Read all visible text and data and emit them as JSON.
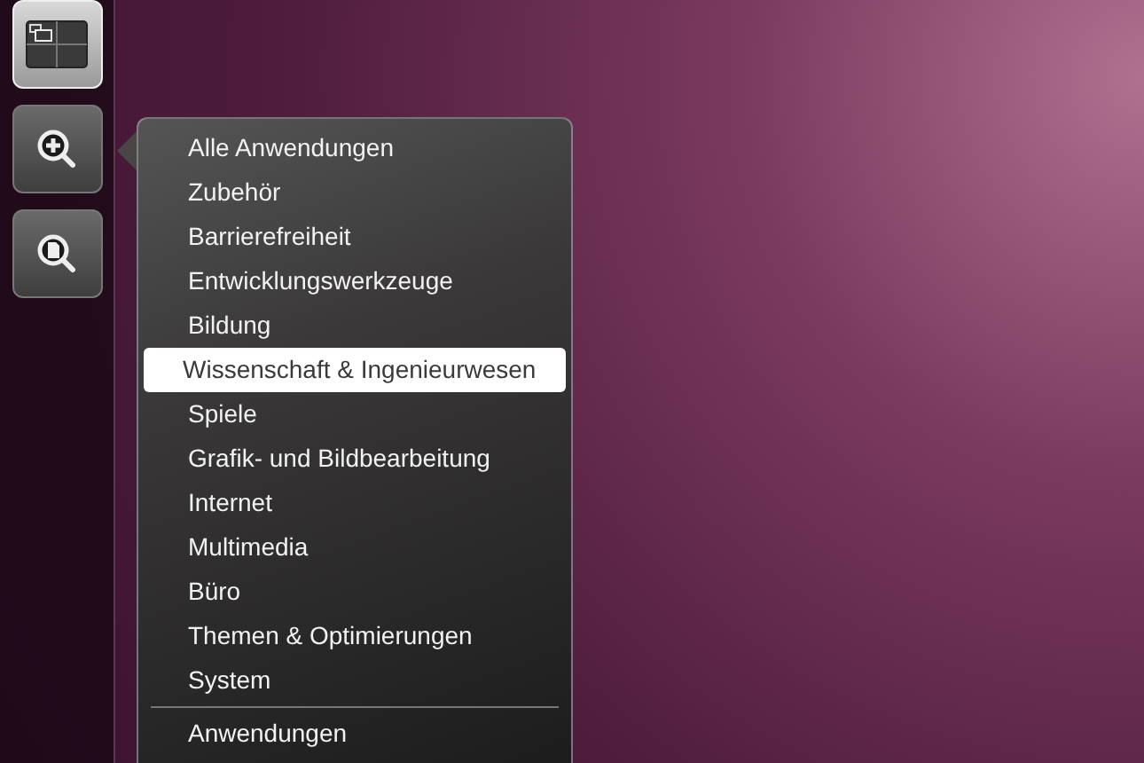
{
  "launcher": [
    {
      "kind": "workspaces",
      "selected": true
    },
    {
      "kind": "apps-lens",
      "selected": false
    },
    {
      "kind": "files-lens",
      "selected": false
    }
  ],
  "menu": {
    "items": [
      {
        "label": "Alle Anwendungen",
        "selected": false
      },
      {
        "label": "Zubehör",
        "selected": false
      },
      {
        "label": "Barrierefreiheit",
        "selected": false
      },
      {
        "label": "Entwicklungswerkzeuge",
        "selected": false
      },
      {
        "label": "Bildung",
        "selected": false
      },
      {
        "label": "Wissenschaft & Ingenieurwesen",
        "selected": true
      },
      {
        "label": "Spiele",
        "selected": false
      },
      {
        "label": "Grafik- und Bildbearbeitung",
        "selected": false
      },
      {
        "label": "Internet",
        "selected": false
      },
      {
        "label": "Multimedia",
        "selected": false
      },
      {
        "label": "Büro",
        "selected": false
      },
      {
        "label": "Themen & Optimierungen",
        "selected": false
      },
      {
        "label": "System",
        "selected": false
      }
    ],
    "footer_items": [
      {
        "label": "Anwendungen",
        "selected": false
      }
    ]
  }
}
